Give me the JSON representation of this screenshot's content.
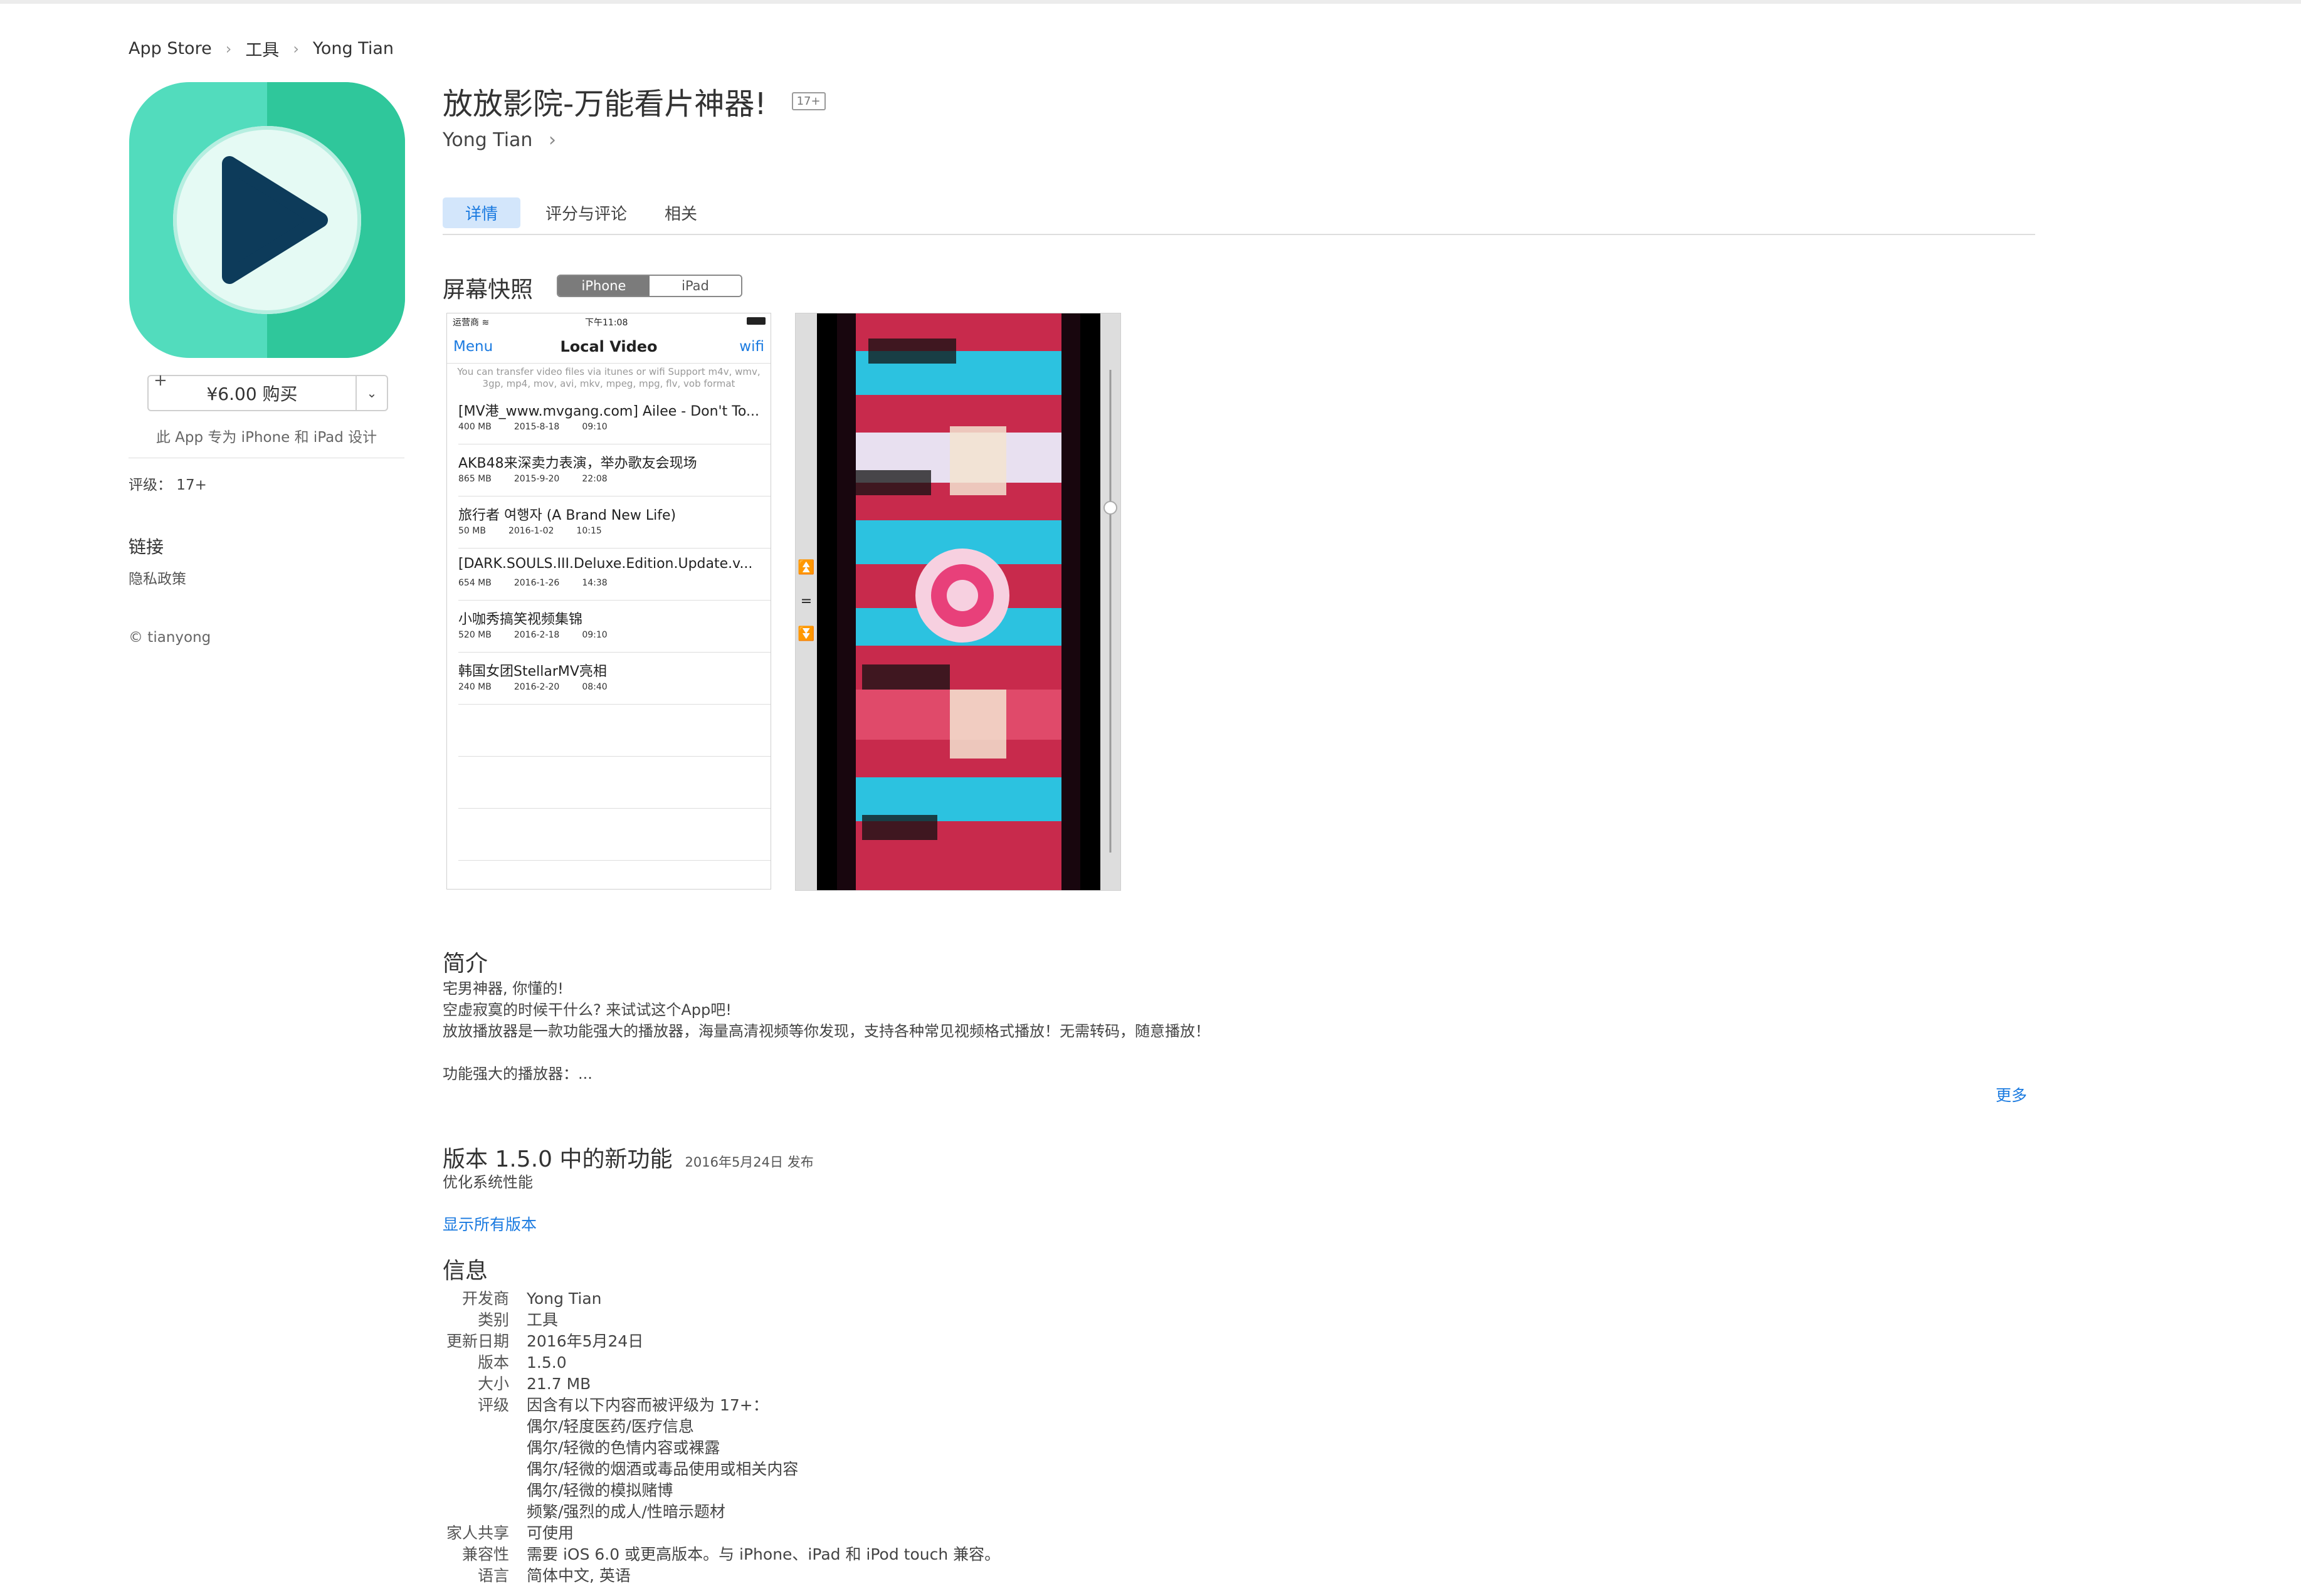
{
  "breadcrumb": {
    "items": [
      "App Store",
      "工具",
      "Yong Tian"
    ]
  },
  "app": {
    "title": "放放影院-万能看片神器!",
    "age_badge": "17+",
    "developer": "Yong Tian",
    "price_button": "¥6.00 购买",
    "designed_for": "此 App 专为 iPhone 和 iPad 设计",
    "rating": "评级： 17+",
    "links_heading": "链接",
    "privacy_link": "隐私政策",
    "copyright": "© tianyong"
  },
  "tabs": [
    "详情",
    "评分与评论",
    "相关"
  ],
  "screenshots": {
    "heading": "屏幕快照",
    "device_tabs": [
      "iPhone",
      "iPad"
    ],
    "phone": {
      "carrier": "运营商 ≋",
      "time": "下午11:08",
      "menu": "Menu",
      "title": "Local Video",
      "wifi": "wifi",
      "hint": "You can transfer video files via itunes or wifi Support m4v, wmv, 3gp, mp4, mov, avi, mkv, mpeg, mpg, flv, vob format",
      "rows": [
        {
          "name": "[MV港_www.mvgang.com] Ailee - Don't To...",
          "size": "400 MB",
          "date": "2015-8-18",
          "time": "09:10"
        },
        {
          "name": "AKB48来深卖力表演，举办歌友会现场",
          "size": "865 MB",
          "date": "2015-9-20",
          "time": "22:08"
        },
        {
          "name": "旅行者 여행자 (A Brand New Life)",
          "size": "50 MB",
          "date": "2016-1-02",
          "time": "10:15"
        },
        {
          "name": "[DARK.SOULS.III.Deluxe.Edition.Update.v...",
          "size": "654 MB",
          "date": "2016-1-26",
          "time": "14:38"
        },
        {
          "name": "小咖秀搞笑视频集锦",
          "size": "520 MB",
          "date": "2016-2-18",
          "time": "09:10"
        },
        {
          "name": "韩国女团StellarMV亮相",
          "size": "240 MB",
          "date": "2016-2-20",
          "time": "08:40"
        }
      ]
    }
  },
  "intro": {
    "heading": "简介",
    "lines": [
      "宅男神器, 你懂的!",
      "空虚寂寞的时候干什么? 来试试这个App吧!",
      "放放播放器是一款功能强大的播放器，海量高清视频等你发现，支持各种常见视频格式播放！无需转码，随意播放！",
      "",
      "功能强大的播放器：..."
    ],
    "more": "更多"
  },
  "version": {
    "heading": "版本 1.5.0 中的新功能",
    "date": "2016年5月24日 发布",
    "notes": "优化系统性能",
    "all_versions": "显示所有版本"
  },
  "info": {
    "heading": "信息",
    "developer": {
      "k": "开发商",
      "v": "Yong Tian"
    },
    "category": {
      "k": "类别",
      "v": "工具"
    },
    "updated": {
      "k": "更新日期",
      "v": "2016年5月24日"
    },
    "version": {
      "k": "版本",
      "v": "1.5.0"
    },
    "size": {
      "k": "大小",
      "v": "21.7 MB"
    },
    "rating": {
      "k": "评级",
      "v": [
        "因含有以下内容而被评级为 17+：",
        "偶尔/轻度医药/医疗信息",
        "偶尔/轻微的色情内容或裸露",
        "偶尔/轻微的烟酒或毒品使用或相关内容",
        "偶尔/轻微的模拟赌博",
        "频繁/强烈的成人/性暗示题材"
      ]
    },
    "family": {
      "k": "家人共享",
      "v": "可使用"
    },
    "compat": {
      "k": "兼容性",
      "v": "需要 iOS 6.0 或更高版本。与 iPhone、iPad 和 iPod touch 兼容。"
    },
    "language": {
      "k": "语言",
      "v": "简体中文, 英语"
    }
  },
  "colors": {
    "accent": "#1a7ae0",
    "icon_light": "#52dcbd",
    "icon_dark": "#2fc79b",
    "play": "#0d3b5a"
  }
}
